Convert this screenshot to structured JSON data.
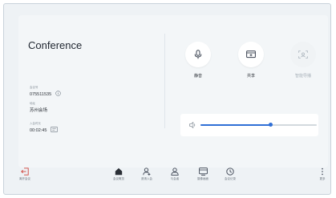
{
  "meeting": {
    "title": "Conference",
    "id_label": "会议号",
    "id_value": "075511535",
    "location_label": "地址",
    "location_value": "苏州会场",
    "duration_label": "入会时长",
    "duration_value": "00:02:45"
  },
  "controls": [
    {
      "label": "静音",
      "icon": "microphone-icon",
      "enabled": true
    },
    {
      "label": "共享",
      "icon": "screen-share-icon",
      "enabled": true
    },
    {
      "label": "智能导播",
      "icon": "smart-camera-icon",
      "enabled": false
    }
  ],
  "volume": {
    "level": 0.6,
    "icon": "speaker-icon",
    "accent": "#2f6fd6"
  },
  "bottom_nav": {
    "leave_label": "离开会议",
    "items": [
      {
        "label": "会议概览",
        "icon": "home-icon",
        "active": true
      },
      {
        "label": "邀请入会",
        "icon": "invite-person-icon",
        "active": false
      },
      {
        "label": "与会者",
        "icon": "participants-icon",
        "active": false
      },
      {
        "label": "摄像画面",
        "icon": "screen-layout-icon",
        "active": false
      },
      {
        "label": "会议记录",
        "icon": "clock-icon",
        "active": false
      }
    ],
    "more_label": "更多"
  }
}
